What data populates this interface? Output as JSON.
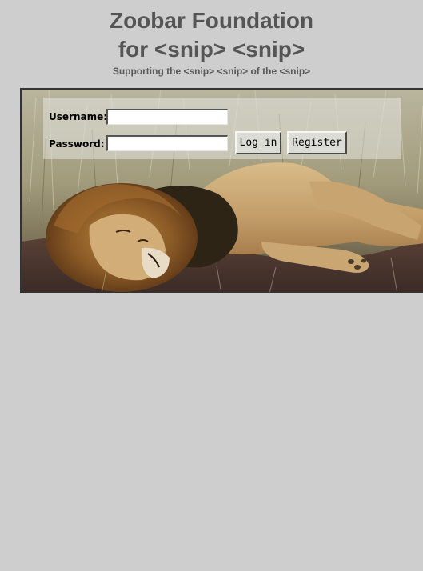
{
  "header": {
    "title_line_1": "Zoobar Foundation",
    "title_line_2": "for <snip> <snip>",
    "subtitle": "Supporting the <snip> <snip> of the <snip>"
  },
  "login_form": {
    "username_label": "Username:",
    "username_value": "",
    "password_label": "Password:",
    "password_value": "",
    "login_button": "Log in",
    "register_button": "Register"
  },
  "banner": {
    "image_subject": "lion-lying-in-grass"
  },
  "colors": {
    "page_background": "#cecece",
    "heading_text": "#555555",
    "banner_border": "#333333"
  }
}
